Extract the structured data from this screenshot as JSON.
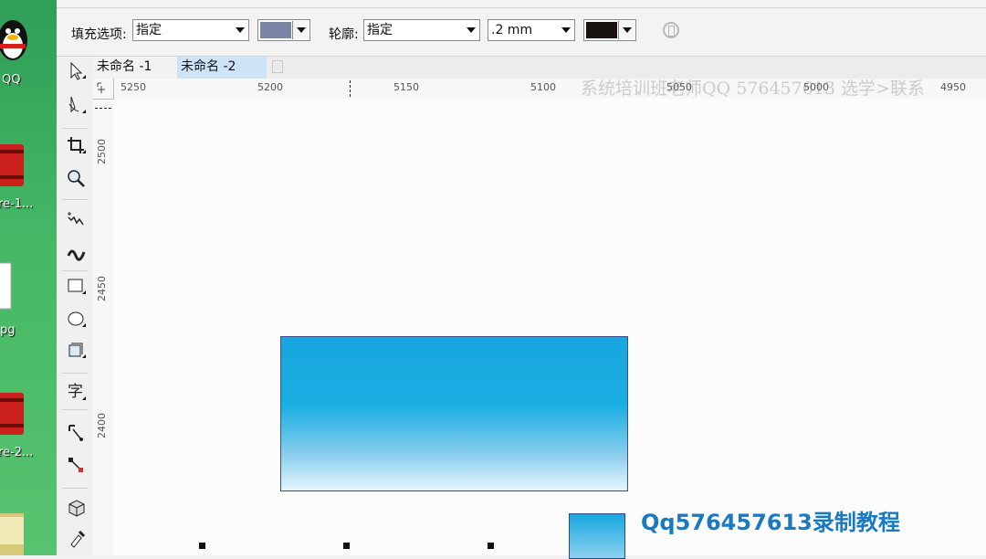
{
  "desktop": {
    "labels": [
      "QQ",
      "re-1...",
      "pg",
      "re-2..."
    ]
  },
  "property_bar": {
    "fill_label": "填充选项:",
    "fill_value": "指定",
    "fill_color": "#7a84a4",
    "outline_label": "轮廓:",
    "outline_value": "指定",
    "outline_width": ".2 mm",
    "outline_color": "#1a1111"
  },
  "tabs": [
    {
      "label": "未命名 -1"
    },
    {
      "label": "未命名 -2"
    }
  ],
  "ruler": {
    "h_ticks": [
      "5250",
      "5200",
      "5150",
      "5100",
      "5050",
      "5000",
      "4950"
    ],
    "v_ticks": [
      "2500",
      "2450",
      "2400"
    ]
  },
  "watermark": "系统培训班老师QQ 576457613 选学>联系",
  "promo": "Qq576457613录制教程",
  "colors": {
    "accent": "#1b79c2",
    "gradient_top": "#18a6df",
    "gradient_bottom": "#e6f5fc"
  },
  "tools": [
    "pick-tool-icon",
    "shape-tool-icon",
    "crop-tool-icon",
    "zoom-tool-icon",
    "freehand-tool-icon",
    "artistic-media-icon",
    "rectangle-tool-icon",
    "ellipse-tool-icon",
    "polygon-tool-icon",
    "text-tool-icon",
    "connector-tool-icon",
    "dimension-tool-icon",
    "extrude-tool-icon",
    "eyedropper-tool-icon"
  ]
}
